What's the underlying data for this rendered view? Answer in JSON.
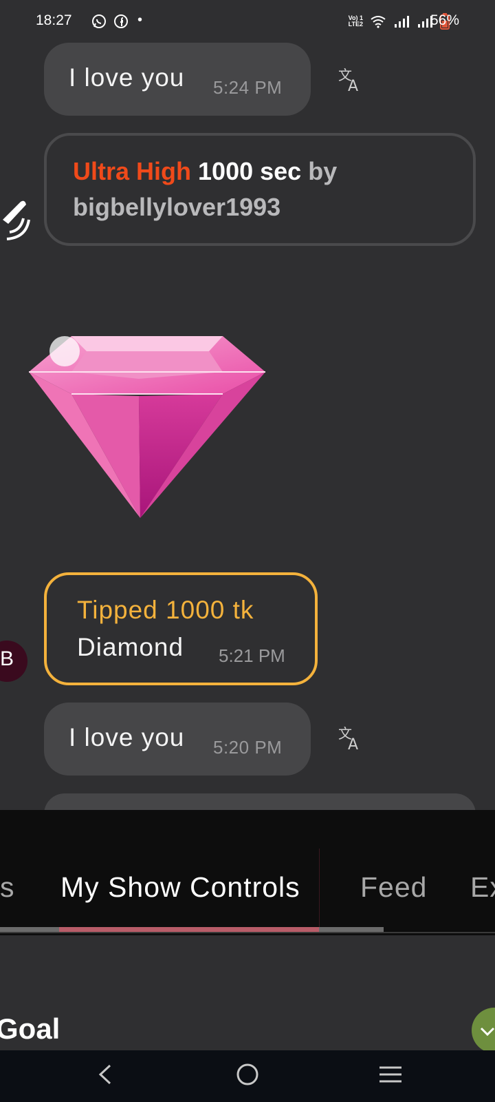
{
  "status_bar": {
    "time": "18:27",
    "network_badge_top": "Vo) 1",
    "network_badge_bottom": "LTE2",
    "battery_percent": "56%",
    "dot": "•"
  },
  "chat": {
    "message_1": {
      "text": "I love you",
      "time": "5:24 PM"
    },
    "vibe_event": {
      "level": "Ultra High",
      "duration": "1000 sec",
      "by_word": "by",
      "username": "bigbellylover1993"
    },
    "tip": {
      "line1": "Tipped 1000 tk",
      "line2": "Diamond",
      "time": "5:21 PM"
    },
    "avatar_letter": "B",
    "message_2": {
      "text": "I love you",
      "time": "5:20 PM"
    }
  },
  "tabs": [
    {
      "label": "s"
    },
    {
      "label": "My Show Controls"
    },
    {
      "label": "Feed"
    },
    {
      "label": "Ex"
    }
  ],
  "section": {
    "title": "Goal"
  },
  "colors": {
    "background": "#2f2f31",
    "bubble": "#464648",
    "ultra_high": "#f04a1a",
    "tip_border": "#f4b23c",
    "tab_indicator": "#b85c68"
  }
}
